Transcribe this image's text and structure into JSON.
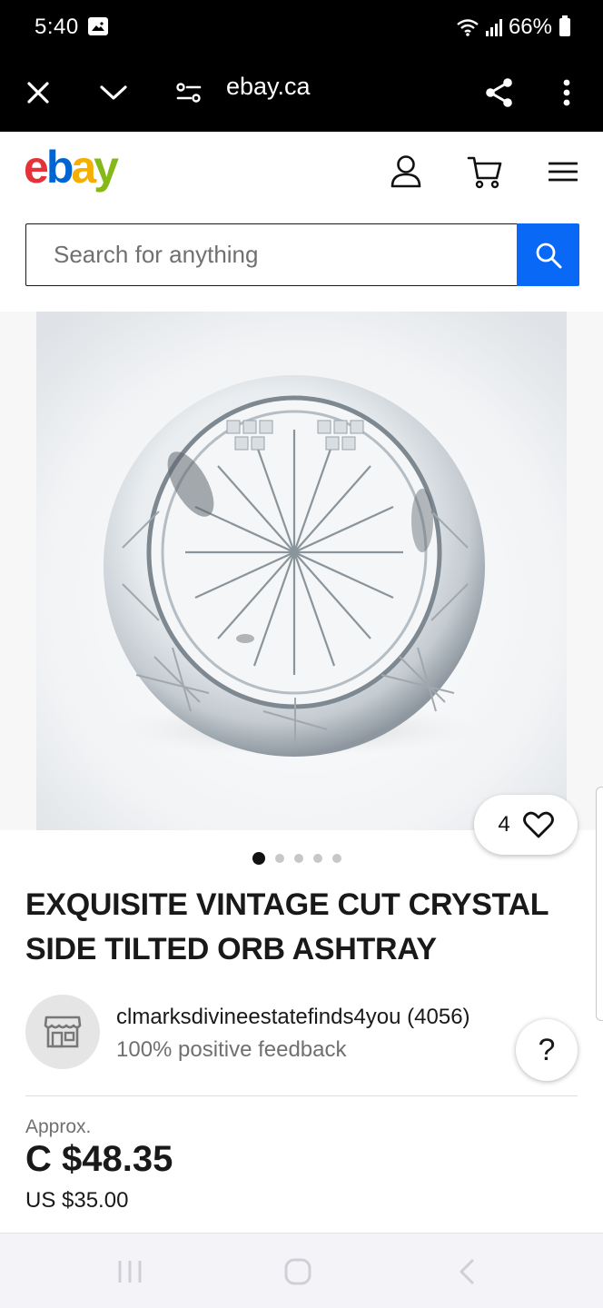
{
  "status": {
    "time": "5:40",
    "battery": "66%"
  },
  "browser": {
    "url": "ebay.ca"
  },
  "header": {
    "logo": {
      "e": "e",
      "b": "b",
      "a": "a",
      "y": "y"
    }
  },
  "search": {
    "placeholder": "Search for anything",
    "value": ""
  },
  "gallery": {
    "watch_count": "4",
    "page_count": 5,
    "active_page": 1
  },
  "listing": {
    "title": "EXQUISITE VINTAGE CUT CRYSTAL SIDE TILTED ORB ASHTRAY",
    "seller_name": "clmarksdivineestatefinds4you (4056)",
    "seller_feedback": "100% positive feedback",
    "help_label": "?",
    "approx_label": "Approx.",
    "price": "C $48.35",
    "price_us": "US $35.00"
  },
  "colors": {
    "accent": "#0968f6",
    "ebay_red": "#e53238",
    "ebay_blue": "#0064d2",
    "ebay_yellow": "#f5af02",
    "ebay_green": "#86b817"
  },
  "icons": [
    "close-icon",
    "chevron-down-icon",
    "page-settings-icon",
    "share-icon",
    "more-vert-icon",
    "user-icon",
    "cart-icon",
    "menu-icon",
    "search-icon",
    "heart-icon",
    "store-icon",
    "recents-icon",
    "home-icon",
    "back-icon"
  ]
}
